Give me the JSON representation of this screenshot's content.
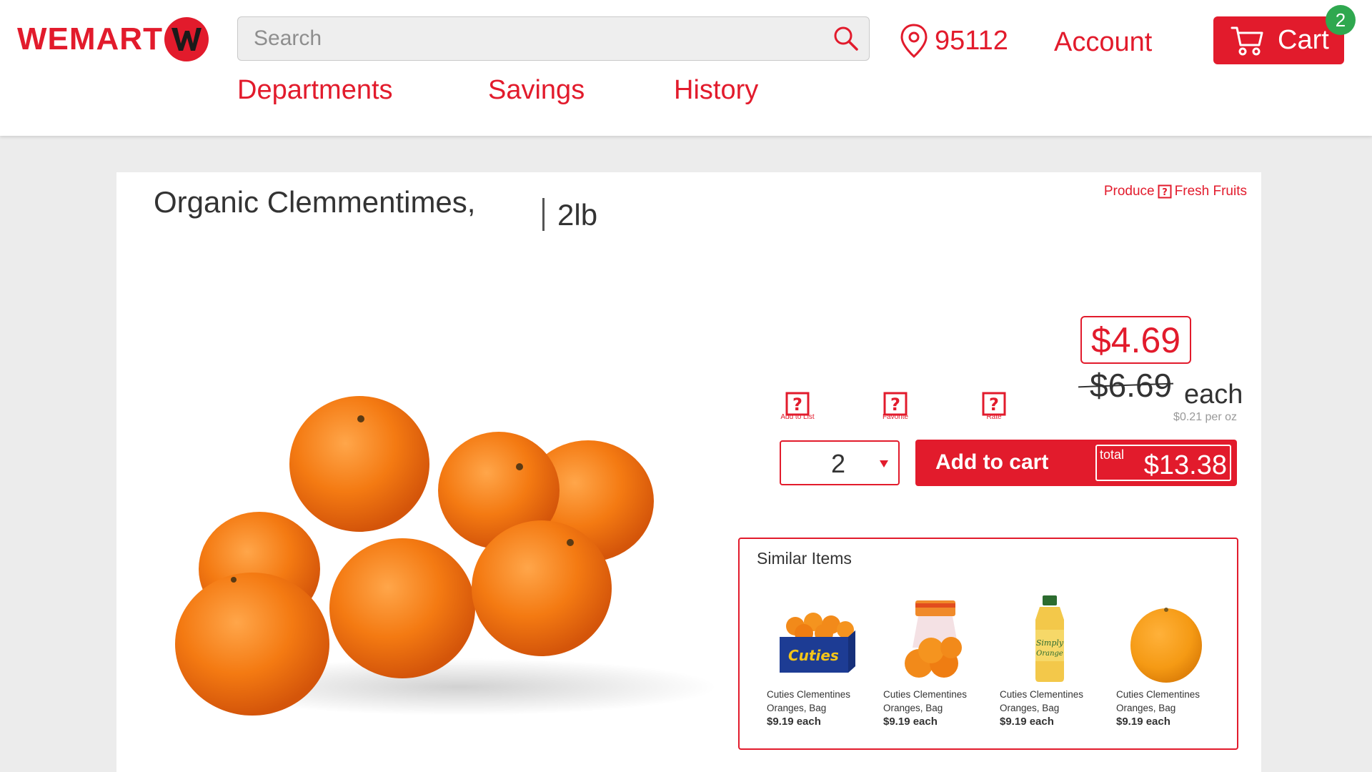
{
  "header": {
    "logo_text": "WEMART",
    "search_placeholder": "Search",
    "zip": "95112",
    "account_label": "Account",
    "cart_label": "Cart",
    "cart_count": "2",
    "nav": [
      "Departments",
      "Savings",
      "History"
    ]
  },
  "product": {
    "title": "Organic Clemmentimes,",
    "size": "2lb",
    "breadcrumb": [
      "Produce",
      "Fresh Fruits"
    ],
    "sale_price": "$4.69",
    "original_price": "$6.69",
    "unit": "each",
    "unit_price": "$0.21 per oz",
    "actions": [
      "Add to List",
      "Favorite",
      "Rate"
    ],
    "quantity": "2",
    "add_to_cart_label": "Add to cart",
    "total_label": "total",
    "total_value": "$13.38"
  },
  "similar": {
    "title": "Similar Items",
    "items": [
      {
        "name": "Cuties Clementines Oranges, Bag",
        "price": "$9.19 each",
        "icon": "cuties-box"
      },
      {
        "name": "Cuties Clementines Oranges, Bag",
        "price": "$9.19 each",
        "icon": "orange-bag"
      },
      {
        "name": "Cuties Clementines Oranges, Bag",
        "price": "$9.19 each",
        "icon": "juice-bottle"
      },
      {
        "name": "Cuties Clementines Oranges, Bag",
        "price": "$9.19 each",
        "icon": "single-orange"
      }
    ]
  },
  "colors": {
    "accent": "#e21b2c",
    "badge": "#2fa84f",
    "background": "#ececec"
  }
}
